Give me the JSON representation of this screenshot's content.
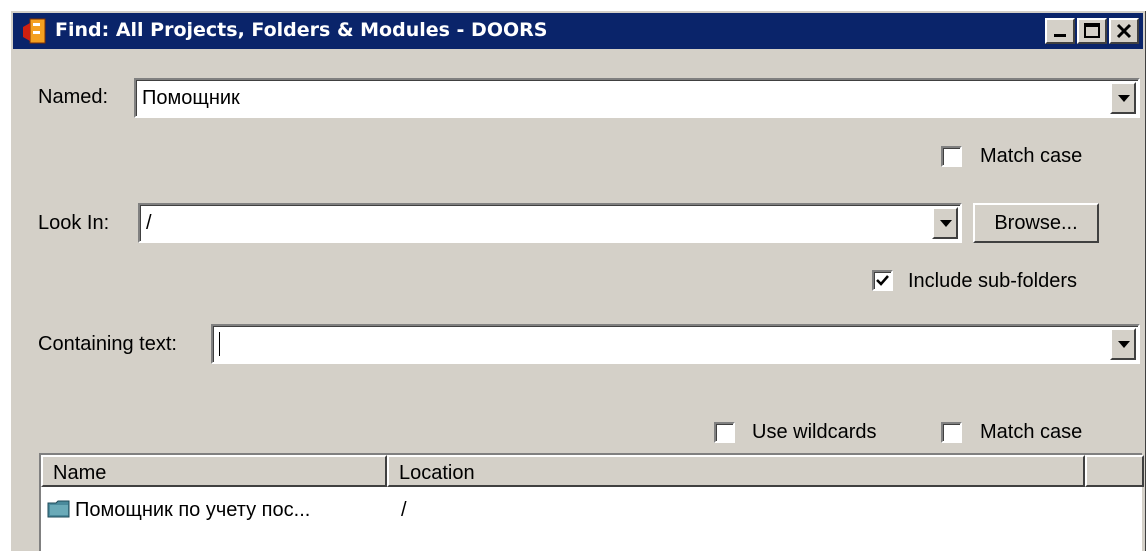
{
  "window": {
    "title": "Find: All Projects, Folders & Modules - DOORS"
  },
  "named": {
    "label": "Named:",
    "value": "Помощник"
  },
  "match_case_1": {
    "label": "Match case",
    "checked": false
  },
  "look_in": {
    "label": "Look In:",
    "value": "/",
    "browse_label": "Browse..."
  },
  "include_subfolders": {
    "label": "Include sub-folders",
    "checked": true
  },
  "containing_text": {
    "label": "Containing text:",
    "value": ""
  },
  "use_wildcards": {
    "label": "Use wildcards",
    "checked": false
  },
  "match_case_2": {
    "label": "Match case",
    "checked": false
  },
  "results": {
    "columns": [
      "Name",
      "Location"
    ],
    "rows": [
      {
        "name": "Помощник по учету пос...",
        "location": "/"
      }
    ]
  },
  "icons": {
    "app": "doors-app-icon",
    "minimize": "minimize-icon",
    "maximize": "maximize-icon",
    "close": "close-icon",
    "dropdown": "chevron-down-icon",
    "folder": "folder-icon",
    "check": "checkmark-icon"
  },
  "colors": {
    "titlebar": "#0a246a",
    "dialog_face": "#d4d0c8",
    "folder": "#4a8a9c"
  }
}
